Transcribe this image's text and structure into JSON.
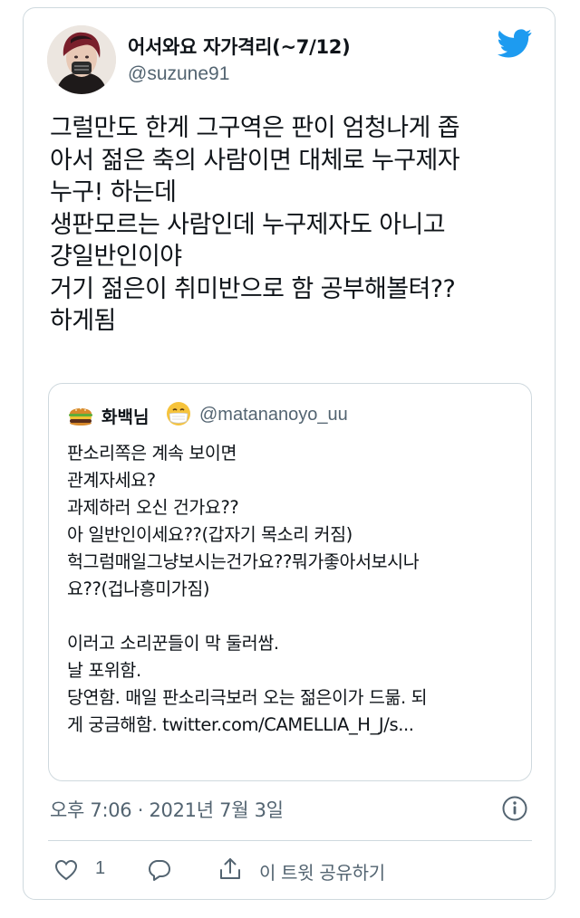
{
  "author": {
    "display_name": "어서와요 자가격리(~7/12)",
    "handle": "@suzune91",
    "avatar_icon": "user-avatar-masked"
  },
  "tweet": {
    "text": "그럴만도 한게 그구역은 판이 엄청나게 좁\n아서 젊은 축의 사람이면 대체로 누구제자\n누구! 하는데\n생판모르는 사람인데 누구제자도 아니고\n걍일반인이야\n거기 젊은이 취미반으로 함 공부해볼텨??\n하게됨"
  },
  "quoted": {
    "display_name": "화백님",
    "handle": "@matananoyo_uu",
    "avatar_icon": "burger-emoji",
    "name_emoji": "mask-face-emoji",
    "text": "판소리쪽은 계속 보이면\n관계자세요?\n과제하러 오신 건가요??\n아 일반인이세요??(갑자기 목소리 커짐)\n헉그럼매일그냥보시는건가요??뭐가좋아서보시나\n요??(겁나흥미가짐)\n\n이러고 소리꾼들이 막 둘러쌈.\n날 포위함.\n당연함. 매일 판소리극보러 오는 젊은이가 드묾. 되\n게 궁금해함. twitter.com/CAMELLIA_H_J/s..."
  },
  "meta": {
    "timestamp": "오후 7:06 · 2021년 7월 3일"
  },
  "actions": {
    "like_count": "1",
    "share_label": "이 트윗 공유하기"
  },
  "colors": {
    "twitter_blue": "#1d9bf0",
    "secondary_text": "#536471",
    "border": "#cfd9de"
  }
}
